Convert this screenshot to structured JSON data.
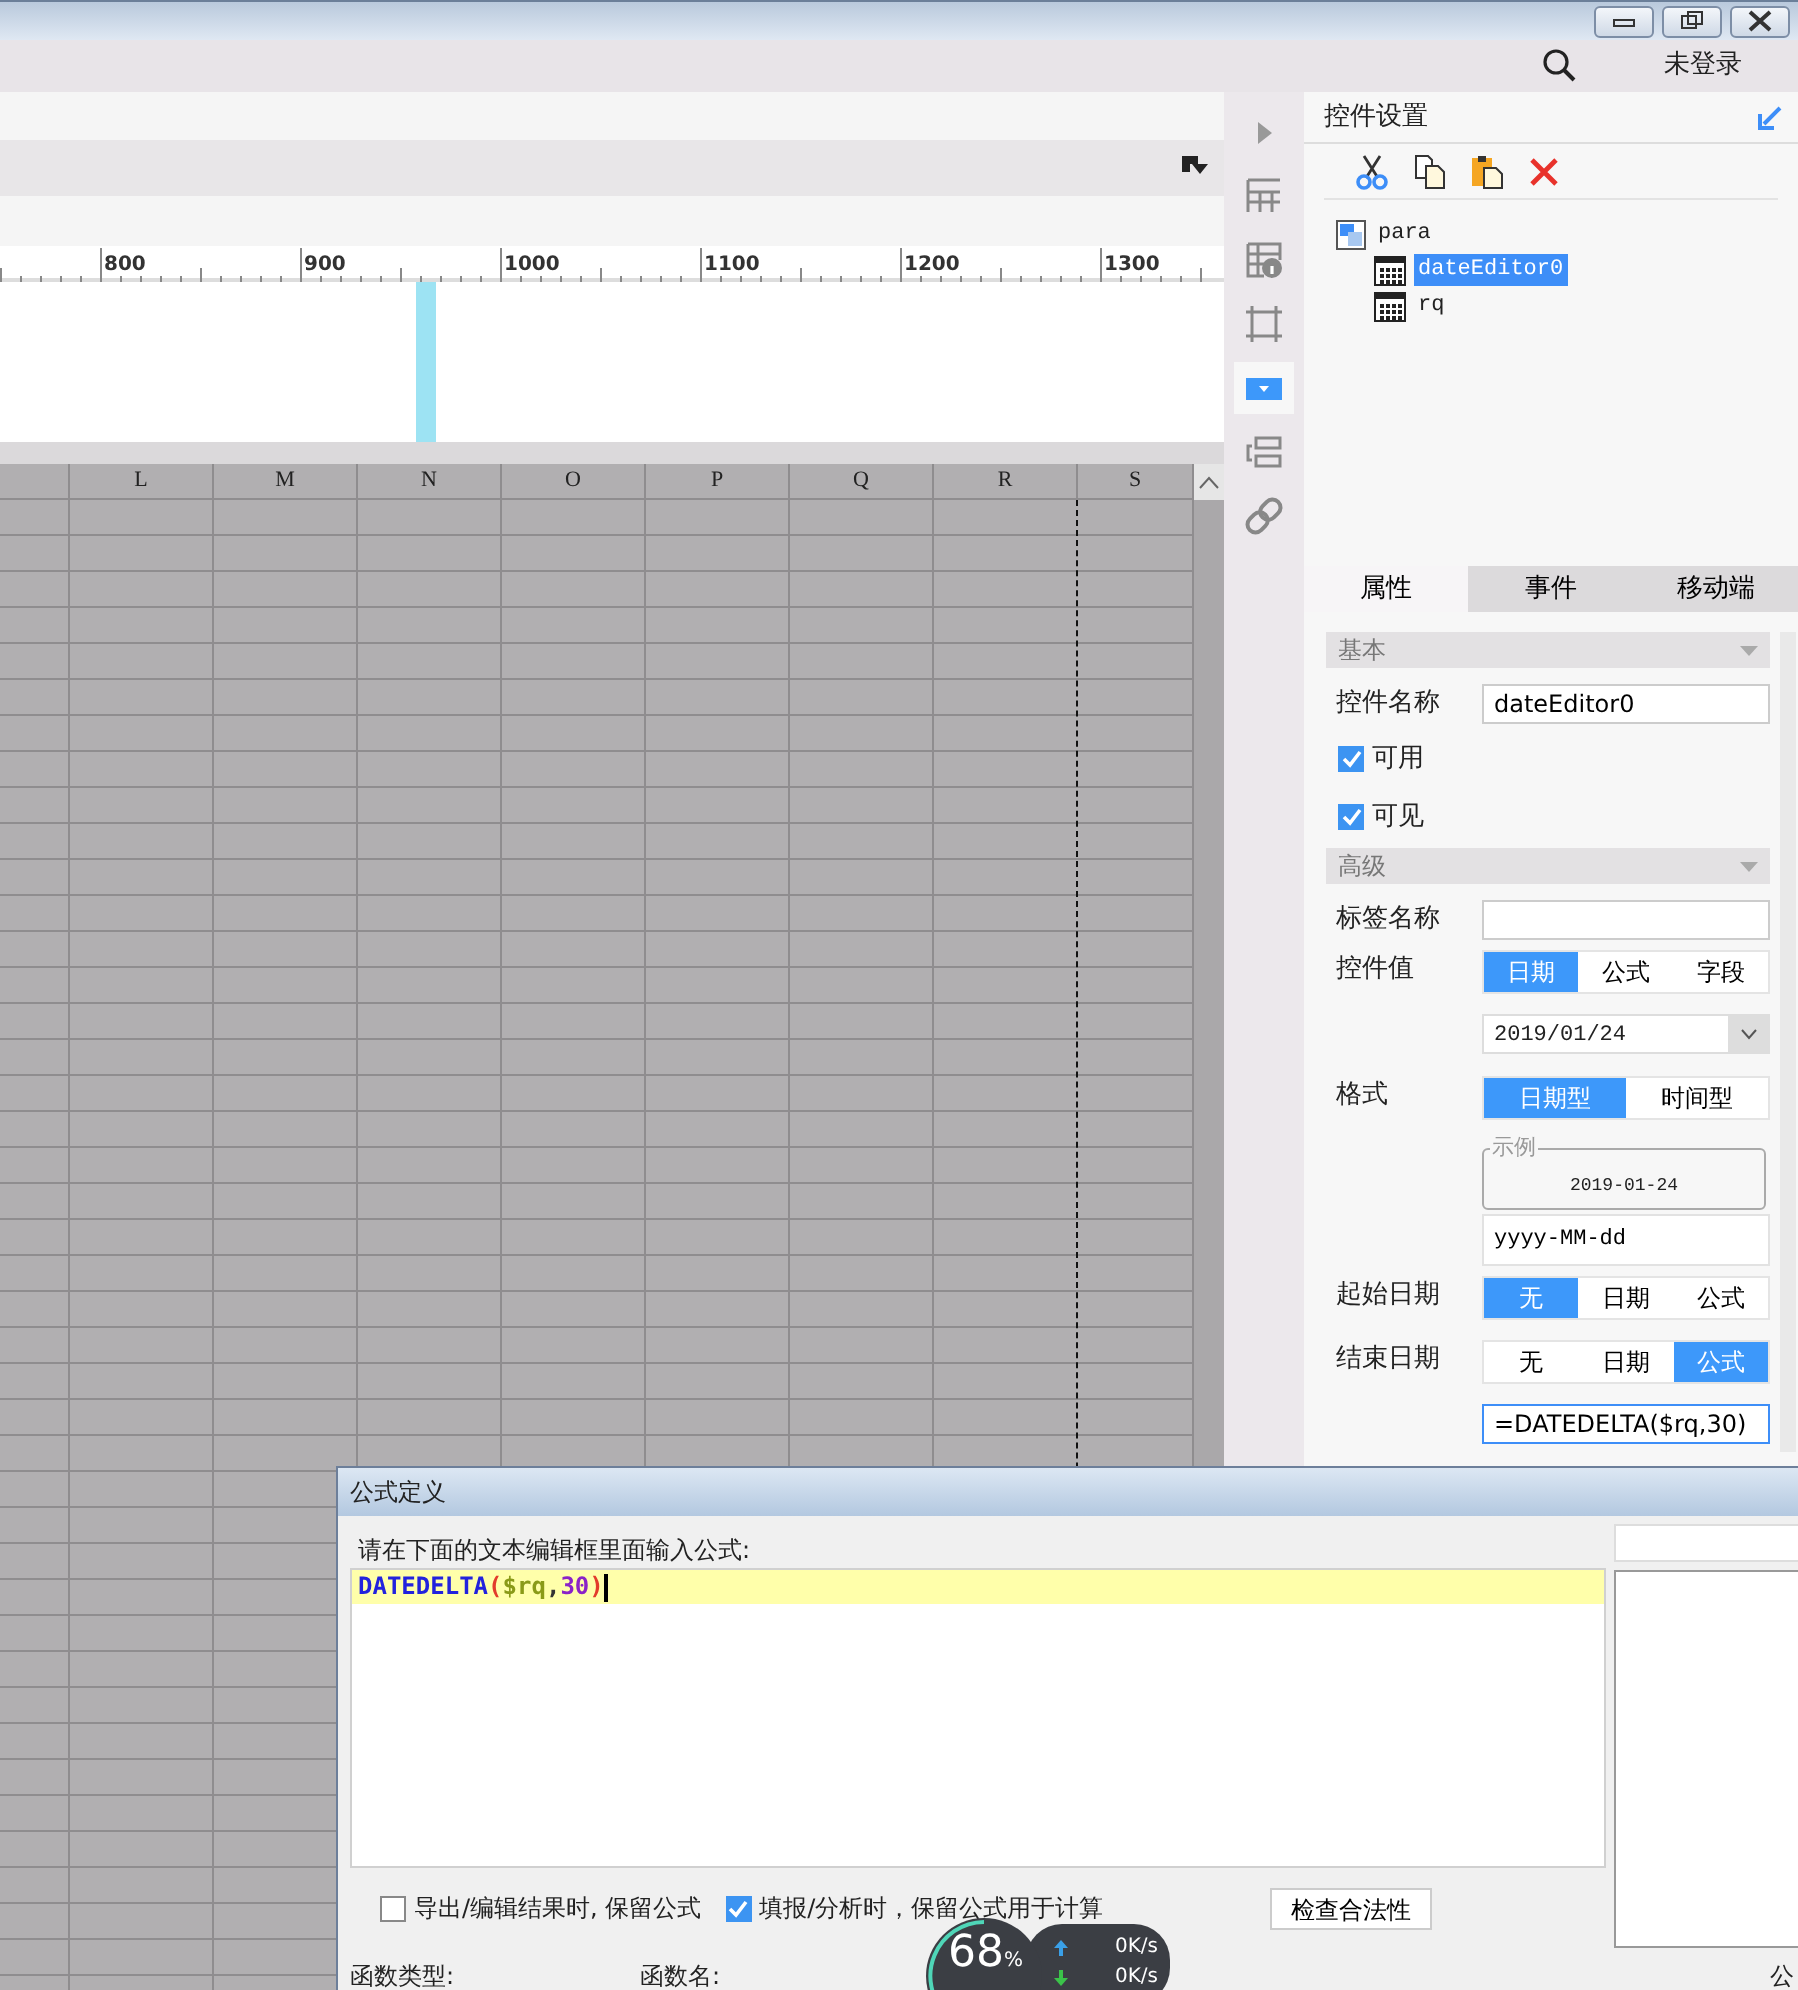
{
  "menu_bar": {
    "account": "未登录"
  },
  "ruler": {
    "labels": [
      "800",
      "900",
      "1000",
      "1100",
      "1200",
      "1300"
    ]
  },
  "sheet": {
    "columns": [
      "L",
      "M",
      "N",
      "O",
      "P",
      "Q",
      "R",
      "S"
    ]
  },
  "tool_strip": [
    {
      "kind": "grid",
      "selected": false
    },
    {
      "kind": "table-info",
      "selected": false
    },
    {
      "kind": "frame",
      "selected": false
    },
    {
      "kind": "dropdown",
      "selected": true
    },
    {
      "kind": "form",
      "selected": false
    },
    {
      "kind": "link",
      "selected": false
    }
  ],
  "panel": {
    "title": "控件设置",
    "tree": [
      {
        "label": "para",
        "kind": "form",
        "selected": false,
        "children": [
          {
            "label": "dateEditor0",
            "kind": "date",
            "selected": true
          },
          {
            "label": "rq",
            "kind": "date",
            "selected": false
          }
        ]
      }
    ],
    "tabs": [
      {
        "label": "属性",
        "selected": true
      },
      {
        "label": "事件",
        "selected": false
      },
      {
        "label": "移动端",
        "selected": false
      }
    ],
    "sections": [
      {
        "title": "基本",
        "rows": [
          {
            "kind": "text",
            "label": "控件名称",
            "value": "dateEditor0"
          },
          {
            "kind": "checkbox",
            "label": "可用",
            "checked": true
          },
          {
            "kind": "checkbox",
            "label": "可见",
            "checked": true
          }
        ]
      },
      {
        "title": "高级",
        "rows": [
          {
            "kind": "text",
            "label": "标签名称"
          },
          {
            "kind": "segmented",
            "label": "控件值",
            "options": [
              {
                "label": "日期",
                "selected": true
              },
              {
                "label": "公式",
                "selected": false
              },
              {
                "label": "字段",
                "selected": false
              }
            ]
          },
          {
            "kind": "select",
            "value": "2019/01/24"
          },
          {
            "kind": "segmented",
            "label": "格式",
            "options": [
              {
                "label": "日期型",
                "selected": true
              },
              {
                "label": "时间型",
                "selected": false
              }
            ]
          },
          {
            "kind": "sample",
            "legend": "示例",
            "value": "2019-01-24"
          },
          {
            "kind": "pattern",
            "value": "yyyy-MM-dd"
          },
          {
            "kind": "segmented",
            "label": "起始日期",
            "options": [
              {
                "label": "无",
                "selected": true
              },
              {
                "label": "日期",
                "selected": false
              },
              {
                "label": "公式",
                "selected": false
              }
            ]
          },
          {
            "kind": "segmented",
            "label": "结束日期",
            "options": [
              {
                "label": "无",
                "selected": false
              },
              {
                "label": "日期",
                "selected": false
              },
              {
                "label": "公式",
                "selected": true
              }
            ]
          },
          {
            "kind": "text",
            "value": "=DATEDELTA($rq,30)",
            "focused": true
          }
        ]
      }
    ]
  },
  "dialog": {
    "title": "公式定义",
    "prompt": "请在下面的文本编辑框里面输入公式:",
    "formula": [
      {
        "text": "DATEDELTA",
        "kind": "function"
      },
      {
        "text": "(",
        "kind": "paren"
      },
      {
        "text": "$rq",
        "kind": "variable"
      },
      {
        "text": ",",
        "kind": "punct"
      },
      {
        "text": "30",
        "kind": "number"
      },
      {
        "text": ")",
        "kind": "paren"
      }
    ],
    "options": [
      {
        "label": "导出/编辑结果时, 保留公式",
        "checked": false
      },
      {
        "label": "填报/分析时，保留公式用于计算",
        "checked": true
      }
    ],
    "check_button": "检查合法性",
    "footer_labels": [
      "函数类型:",
      "函数名:"
    ],
    "right_label": "公"
  },
  "net_widget": {
    "percent": "68",
    "unit": "%",
    "upload": "0K/s",
    "download": "0K/s"
  }
}
